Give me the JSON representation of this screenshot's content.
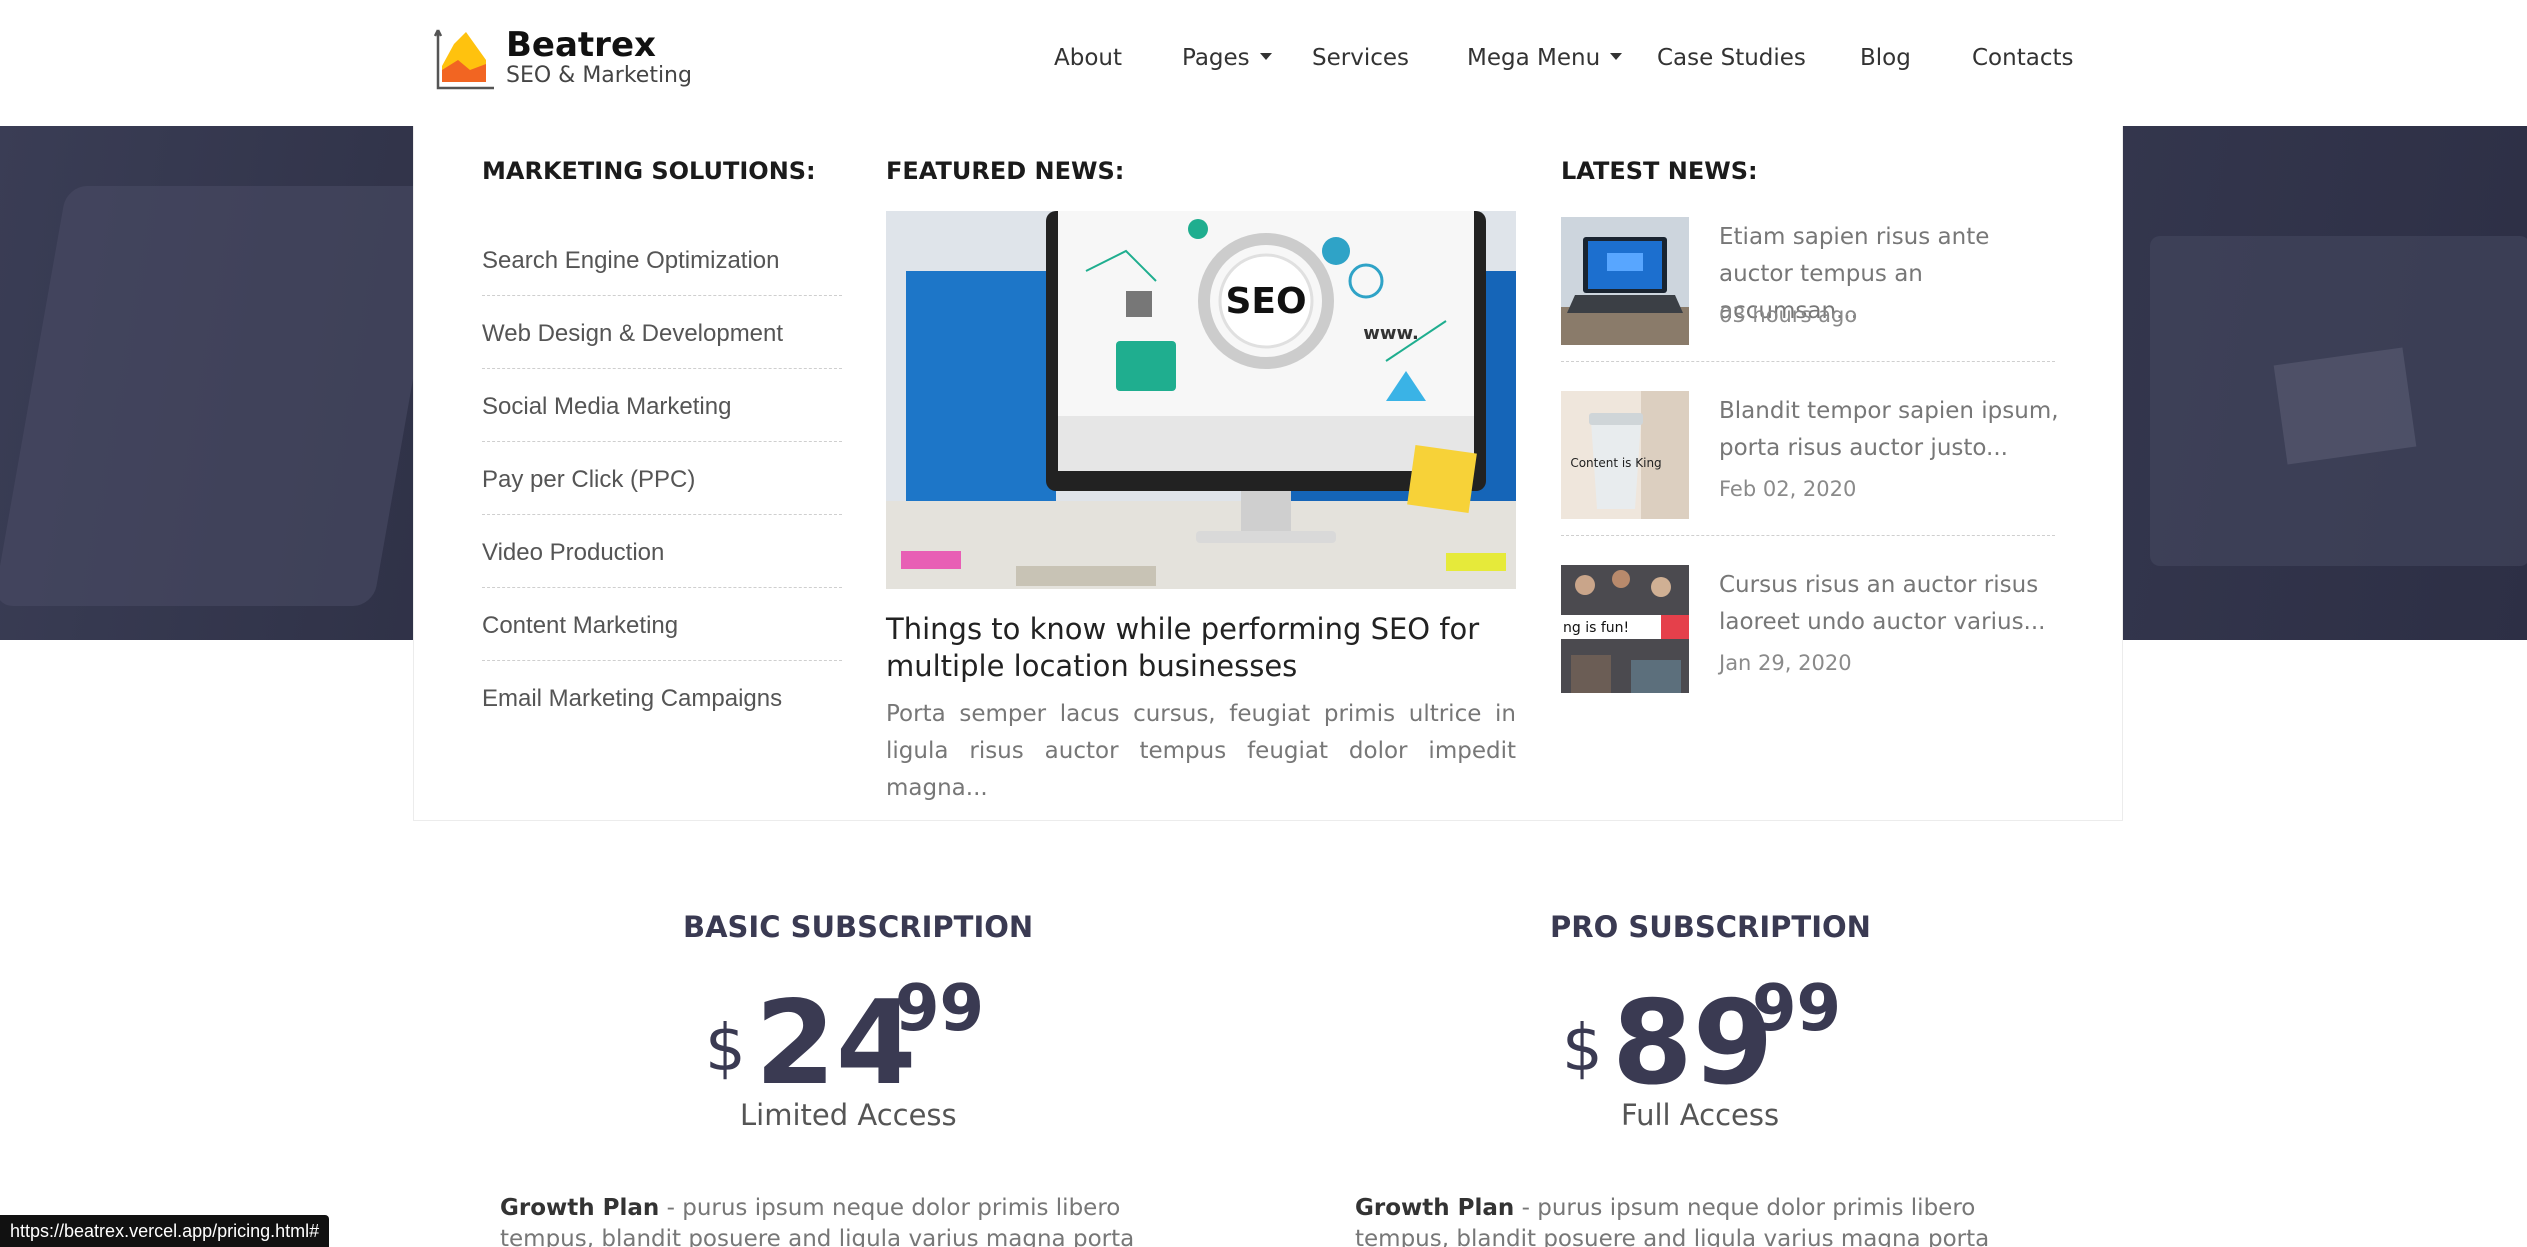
{
  "brand": {
    "name": "Beatrex",
    "tagline": "SEO & Marketing"
  },
  "nav": [
    {
      "label": "About",
      "has_dropdown": false
    },
    {
      "label": "Pages",
      "has_dropdown": true
    },
    {
      "label": "Services",
      "has_dropdown": false
    },
    {
      "label": "Mega Menu",
      "has_dropdown": true
    },
    {
      "label": "Case Studies",
      "has_dropdown": false
    },
    {
      "label": "Blog",
      "has_dropdown": false
    },
    {
      "label": "Contacts",
      "has_dropdown": false
    }
  ],
  "mega_menu": {
    "solutions_heading": "MARKETING SOLUTIONS:",
    "solutions": [
      "Search Engine Optimization",
      "Web Design & Development",
      "Social Media Marketing",
      "Pay per Click (PPC)",
      "Video Production",
      "Content Marketing",
      "Email Marketing Campaigns"
    ],
    "featured_heading": "FEATURED NEWS:",
    "featured": {
      "title": "Things to know while performing SEO for multiple location businesses",
      "excerpt": "Porta semper lacus cursus, feugiat primis ultrice in ligula risus auctor tempus feugiat dolor impedit magna...",
      "image_text": "SEO",
      "image_subtext": "www."
    },
    "latest_heading": "LATEST NEWS:",
    "latest": [
      {
        "title": "Etiam sapien risus ante auctor tempus an accumsan...",
        "date": "03 hours ago"
      },
      {
        "title": "Blandit tempor sapien ipsum, porta risus auctor justo...",
        "date": "Feb 02, 2020",
        "image_text": "Content is King"
      },
      {
        "title": "Cursus risus an auctor risus laoreet undo auctor varius...",
        "date": "Jan 29, 2020",
        "image_text": "ng is fun!"
      }
    ]
  },
  "pricing": [
    {
      "title": "BASIC SUBSCRIPTION",
      "currency": "$",
      "amount": "24",
      "cents": "99",
      "access": "Limited Access",
      "plan_name": "Growth Plan",
      "plan_desc": " - purus ipsum neque dolor primis libero tempus, blandit posuere and ligula varius magna porta"
    },
    {
      "title": "PRO SUBSCRIPTION",
      "currency": "$",
      "amount": "89",
      "cents": "99",
      "access": "Full Access",
      "plan_name": "Growth Plan",
      "plan_desc": " - purus ipsum neque dolor primis libero tempus, blandit posuere and ligula varius magna porta"
    }
  ],
  "status_bar_url": "https://beatrex.vercel.app/pricing.html#",
  "colors": {
    "heading": "#3a3a52",
    "hero": "#2e3046",
    "logo_orange": "#f7931e",
    "logo_yellow": "#ffc20e"
  }
}
